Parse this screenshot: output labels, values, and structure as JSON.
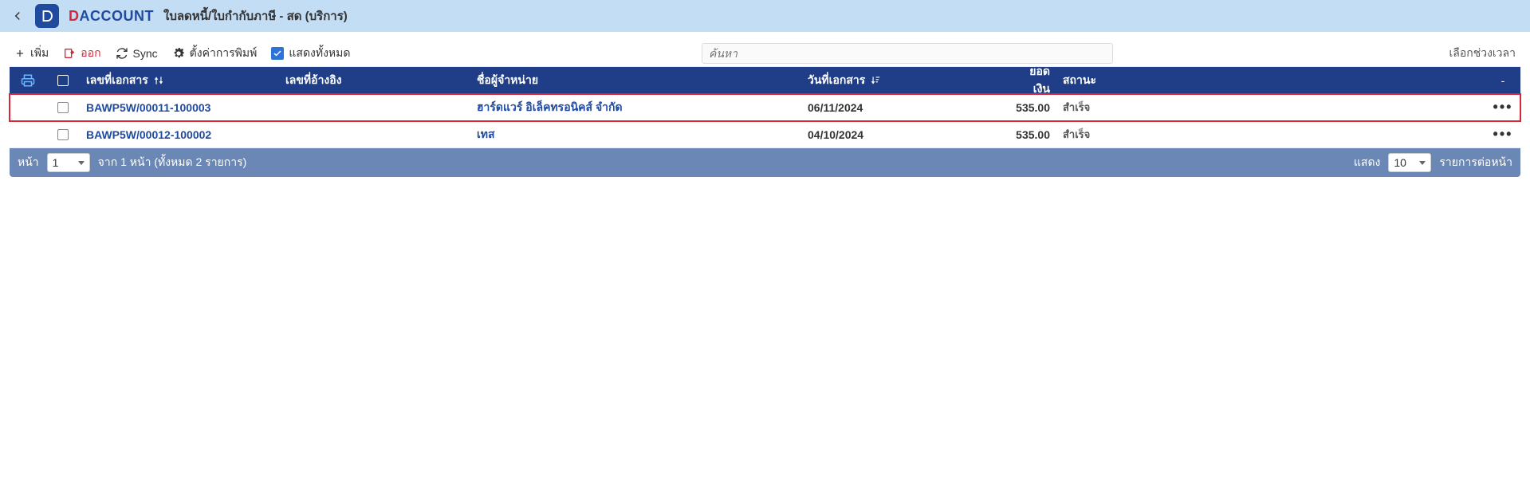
{
  "header": {
    "page_title": "ใบลดหนี้/ใบกำกับภาษี - สด (บริการ)"
  },
  "toolbar": {
    "add": "เพิ่ม",
    "export": "ออก",
    "sync": "Sync",
    "print_settings": "ตั้งค่าการพิมพ์",
    "show_all": "แสดงทั้งหมด",
    "search_placeholder": "ค้นหา",
    "date_range": "เลือกช่วงเวลา"
  },
  "columns": {
    "docno": "เลขที่เอกสาร",
    "ref": "เลขที่อ้างอิง",
    "vendor": "ชื่อผู้จำหน่าย",
    "date": "วันที่เอกสาร",
    "amount": "ยอดเงิน",
    "status": "สถานะ",
    "actions": "-"
  },
  "rows": [
    {
      "docno": "BAWP5W/00011-100003",
      "ref": "",
      "vendor": "ฮาร์ดแวร์ อิเล็คทรอนิคส์ จำกัด",
      "date": "06/11/2024",
      "amount": "535.00",
      "status": "สำเร็จ",
      "selected": true
    },
    {
      "docno": "BAWP5W/00012-100002",
      "ref": "",
      "vendor": "เทส",
      "date": "04/10/2024",
      "amount": "535.00",
      "status": "สำเร็จ",
      "selected": false
    }
  ],
  "pager": {
    "page_label": "หน้า",
    "page_value": "1",
    "summary": "จาก 1 หน้า (ทั้งหมด 2 รายการ)",
    "show_label": "แสดง",
    "per_page_value": "10",
    "per_page_suffix": "รายการต่อหน้า"
  }
}
